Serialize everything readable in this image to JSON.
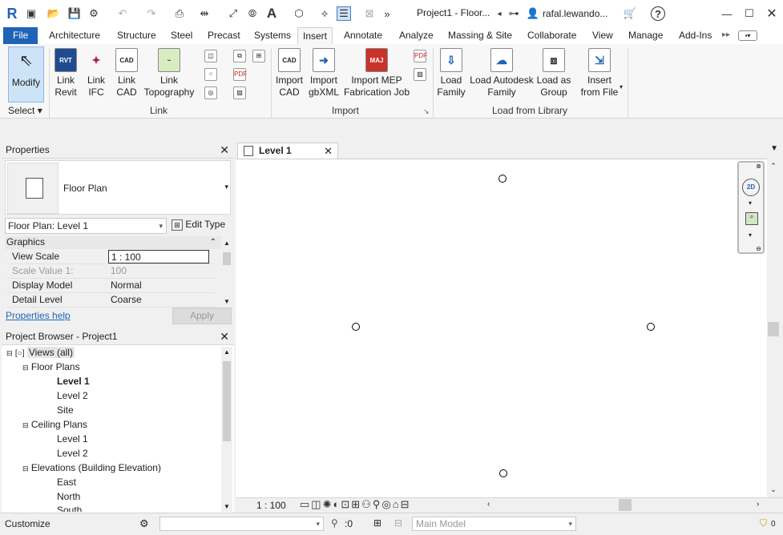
{
  "app": {
    "title": "Project1 - Floor...",
    "user": "rafal.lewando..."
  },
  "ribbon_tabs": [
    "File",
    "Architecture",
    "Structure",
    "Steel",
    "Precast",
    "Systems",
    "Insert",
    "Annotate",
    "Analyze",
    "Massing & Site",
    "Collaborate",
    "View",
    "Manage",
    "Add-Ins"
  ],
  "ribbon": {
    "modify": "Modify",
    "select": "Select",
    "link_revit": [
      "Link",
      "Revit"
    ],
    "link_ifc": [
      "Link",
      "IFC"
    ],
    "link_cad": [
      "Link",
      "CAD"
    ],
    "link_topo": [
      "Link",
      "Topography"
    ],
    "import_cad": [
      "Import",
      "CAD"
    ],
    "import_gbxml": [
      "Import",
      "gbXML"
    ],
    "import_mep": [
      "Import MEP",
      "Fabrication Job"
    ],
    "load_family": [
      "Load",
      "Family"
    ],
    "load_autodesk": [
      "Load Autodesk",
      "Family"
    ],
    "load_group": [
      "Load as",
      "Group"
    ],
    "insert_file": [
      "Insert",
      "from File"
    ],
    "panel_link": "Link",
    "panel_import": "Import",
    "panel_library": "Load from Library"
  },
  "properties": {
    "header": "Properties",
    "type_name": "Floor Plan",
    "instance": "Floor Plan: Level 1",
    "edit_type": "Edit Type",
    "section": "Graphics",
    "rows": [
      {
        "k": "View Scale",
        "v": "1 : 100"
      },
      {
        "k": "Scale Value    1:",
        "v": "100"
      },
      {
        "k": "Display Model",
        "v": "Normal"
      },
      {
        "k": "Detail Level",
        "v": "Coarse"
      }
    ],
    "help": "Properties help",
    "apply": "Apply"
  },
  "browser": {
    "header": "Project Browser - Project1",
    "items": [
      {
        "t": "Views (all)"
      },
      {
        "t": "Floor Plans"
      },
      {
        "t": "Level 1"
      },
      {
        "t": "Level 2"
      },
      {
        "t": "Site"
      },
      {
        "t": "Ceiling Plans"
      },
      {
        "t": "Level 1"
      },
      {
        "t": "Level 2"
      },
      {
        "t": "Elevations (Building Elevation)"
      },
      {
        "t": "East"
      },
      {
        "t": "North"
      },
      {
        "t": "South"
      }
    ]
  },
  "view": {
    "tab": "Level 1",
    "scale": "1 : 100"
  },
  "status": {
    "text": "Customize",
    "zero": ":0",
    "model": "Main Model",
    "filter": "0"
  }
}
